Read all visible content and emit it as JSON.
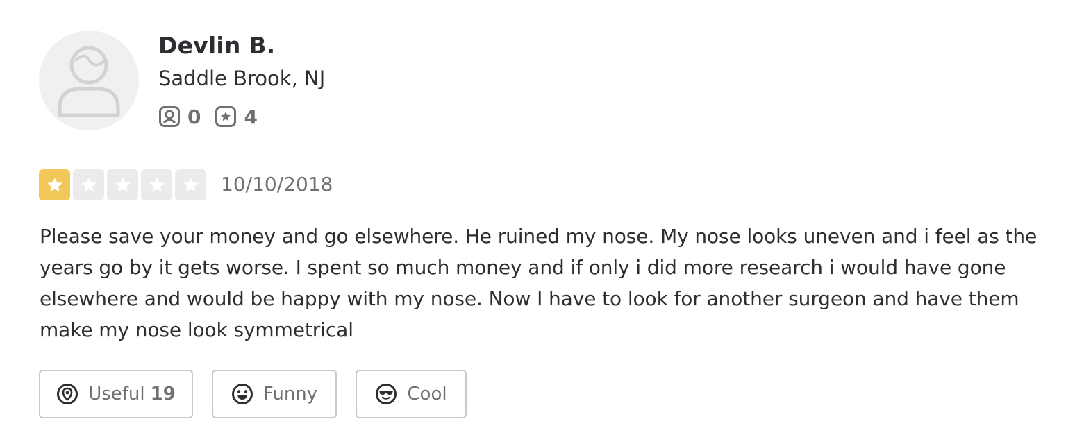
{
  "user": {
    "name": "Devlin B.",
    "location": "Saddle Brook, NJ",
    "friends_count": "0",
    "reviews_count": "4",
    "avatar_icon": "default-avatar-icon",
    "friends_icon": "friends-icon",
    "reviews_icon": "review-star-icon"
  },
  "review": {
    "rating": 1,
    "rating_max": 5,
    "date": "10/10/2018",
    "text": "Please save your money and go elsewhere. He ruined my nose. My nose looks uneven and i feel as the years go by it gets worse. I spent so much money and if only i did more research i would have gone elsewhere and would be happy with my nose. Now I have to look for another surgeon and have them make my nose look symmetrical"
  },
  "reactions": {
    "useful_label": "Useful",
    "useful_count": "19",
    "funny_label": "Funny",
    "cool_label": "Cool"
  },
  "colors": {
    "star_filled": "#f2c85b",
    "star_empty": "#ebebeb",
    "text_dark": "#2d2e32",
    "text_muted": "#6e7072",
    "border": "#c8c9ca"
  }
}
